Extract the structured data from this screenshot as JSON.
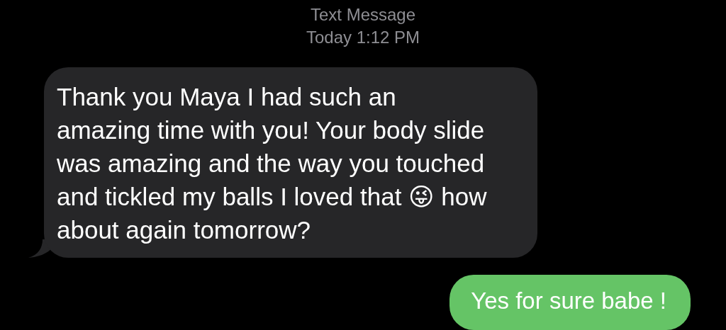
{
  "header": {
    "service": "Text Message",
    "timestamp": "Today 1:12 PM"
  },
  "messages": [
    {
      "kind": "received",
      "text": "Thank you Maya I had such an amazing time with you! Your body slide was amazing and the way you touched and tickled my balls I loved that 😜 how about again tomorrow?"
    },
    {
      "kind": "sent",
      "text": "Yes for sure babe !"
    }
  ]
}
